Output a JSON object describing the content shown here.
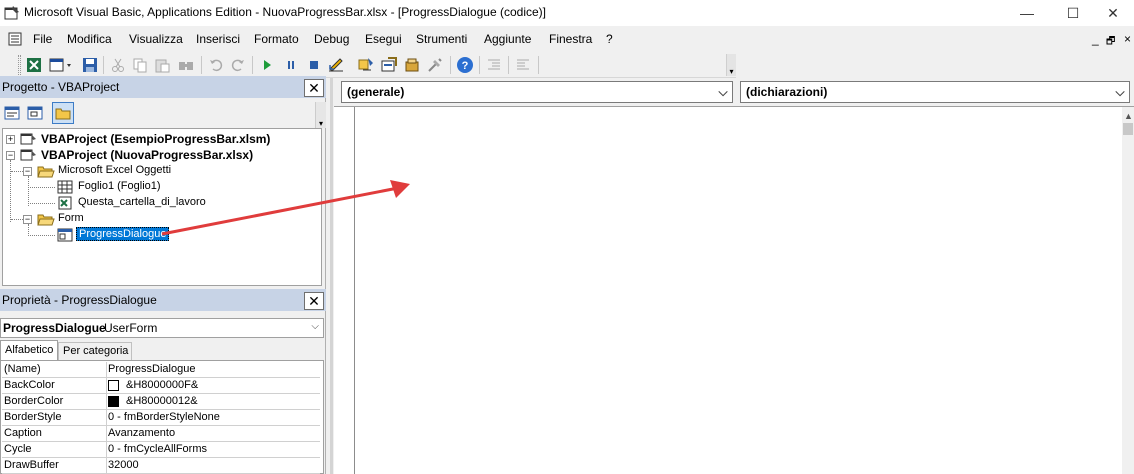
{
  "window": {
    "title": "Microsoft Visual Basic, Applications Edition - NuovaProgressBar.xlsx - [ProgressDialogue (codice)]",
    "controls": {
      "minimize": "—",
      "maximize": "☐",
      "close": "✕"
    }
  },
  "menu": {
    "items": [
      "File",
      "Modifica",
      "Visualizza",
      "Inserisci",
      "Formato",
      "Debug",
      "Esegui",
      "Strumenti",
      "Aggiunte",
      "Finestra",
      "?"
    ],
    "mdi_controls": {
      "minimize": "_",
      "restore": "🗗",
      "close": "×"
    }
  },
  "toolbar": {
    "buttons": [
      "excel-view-icon",
      "insert-userform-icon",
      "save-icon",
      "cut-icon",
      "copy-icon",
      "paste-icon",
      "find-icon",
      "undo-icon",
      "redo-icon",
      "run-icon",
      "break-icon",
      "reset-icon",
      "design-mode-icon",
      "project-explorer-icon",
      "properties-icon",
      "object-browser-icon",
      "toolbox-icon",
      "help-icon",
      "indent-icon",
      "outdent-icon"
    ]
  },
  "project_pane": {
    "title": "Progetto - VBAProject",
    "close": "✕",
    "tree": {
      "project1": "VBAProject (EsempioProgressBar.xlsm)",
      "project2": "VBAProject (NuovaProgressBar.xlsx)",
      "excel_objects": "Microsoft Excel Oggetti",
      "sheet1": "Foglio1 (Foglio1)",
      "workbook": "Questa_cartella_di_lavoro",
      "forms": "Form",
      "form1": "ProgressDialogue"
    }
  },
  "properties_pane": {
    "title": "Proprietà - ProgressDialogue",
    "close": "✕",
    "object_name": "ProgressDialogue",
    "object_type": "UserForm",
    "tabs": [
      "Alfabetico",
      "Per categoria"
    ],
    "rows": [
      {
        "name": "(Name)",
        "value": "ProgressDialogue"
      },
      {
        "name": "BackColor",
        "value": "&H8000000F&",
        "swatch": "#ffffff"
      },
      {
        "name": "BorderColor",
        "value": "&H80000012&",
        "swatch": "#000000"
      },
      {
        "name": "BorderStyle",
        "value": "0 - fmBorderStyleNone"
      },
      {
        "name": "Caption",
        "value": "Avanzamento"
      },
      {
        "name": "Cycle",
        "value": "0 - fmCycleAllForms"
      },
      {
        "name": "DrawBuffer",
        "value": "32000"
      }
    ]
  },
  "code_pane": {
    "object_combo": "(generale)",
    "procedure_combo": "(dichiarazioni)"
  },
  "colors": {
    "pane_title_bg": "#c7d3e6",
    "selection": "#0078d7",
    "arrow": "#e03c3c"
  }
}
